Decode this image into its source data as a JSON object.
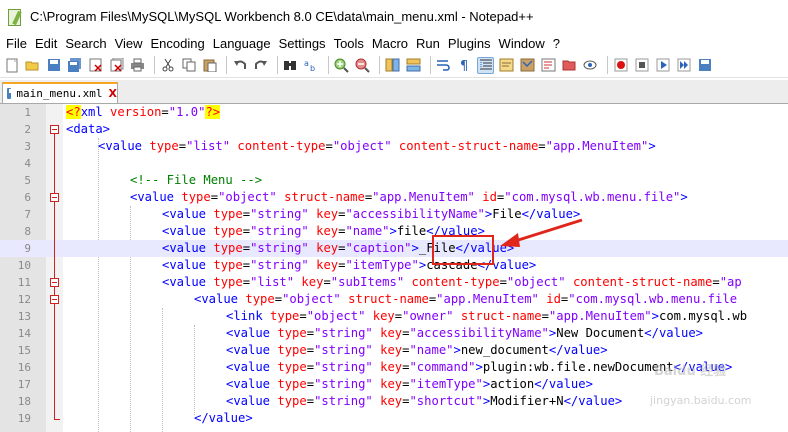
{
  "window": {
    "title": "C:\\Program Files\\MySQL\\MySQL Workbench 8.0 CE\\data\\main_menu.xml - Notepad++"
  },
  "menu": [
    "File",
    "Edit",
    "Search",
    "View",
    "Encoding",
    "Language",
    "Settings",
    "Tools",
    "Macro",
    "Run",
    "Plugins",
    "Window",
    "?"
  ],
  "toolbar": {
    "buttons": [
      "new-file",
      "open-file",
      "save",
      "save-all",
      "close",
      "close-all",
      "print",
      "cut",
      "copy",
      "paste",
      "undo",
      "redo",
      "find",
      "replace",
      "zoom-in",
      "zoom-out",
      "sync-vertical",
      "sync-horizontal",
      "word-wrap",
      "show-all-chars",
      "indent-guide",
      "user-language",
      "doc-map",
      "function-list",
      "folder-as-workspace",
      "monitor",
      "record-macro",
      "stop-record",
      "play-macro",
      "run-macro-multiple",
      "save-macro"
    ]
  },
  "tab": {
    "label": "main_menu.xml",
    "close": "X"
  },
  "editor": {
    "current_line": 9,
    "lines": [
      {
        "n": "1"
      },
      {
        "n": "2"
      },
      {
        "n": "3"
      },
      {
        "n": "4"
      },
      {
        "n": "5"
      },
      {
        "n": "6"
      },
      {
        "n": "7"
      },
      {
        "n": "8"
      },
      {
        "n": "9"
      },
      {
        "n": "10"
      },
      {
        "n": "11"
      },
      {
        "n": "12"
      },
      {
        "n": "13"
      },
      {
        "n": "14"
      },
      {
        "n": "15"
      },
      {
        "n": "16"
      },
      {
        "n": "17"
      },
      {
        "n": "18"
      },
      {
        "n": "19"
      }
    ],
    "code": {
      "l1": {
        "pi_open": "<?",
        "tag": "xml",
        "attr": " version",
        "eq": "=",
        "val": "\"1.0\"",
        "pi_close": "?>"
      },
      "l2": {
        "tag": "<data>"
      },
      "l3": {
        "a": "<value",
        "b": " type",
        "c": "=",
        "d": "\"list\"",
        "e": " content-type",
        "f": "=",
        "g": "\"object\"",
        "h": " content-struct-name",
        "i": "=",
        "j": "\"app.MenuItem\"",
        "k": ">"
      },
      "l5": {
        "comment": "<!-- File Menu -->"
      },
      "l6": {
        "a": "<value",
        "b": " type",
        "c": "=",
        "d": "\"object\"",
        "e": " struct-name",
        "f": "=",
        "g": "\"app.MenuItem\"",
        "h": " id",
        "i": "=",
        "j": "\"com.mysql.wb.menu.file\"",
        "k": ">"
      },
      "l7": {
        "a": "<value",
        "b": " type",
        "c": "=",
        "d": "\"string\"",
        "e": " key",
        "f": "=",
        "g": "\"accessibilityName\"",
        "h": ">",
        "t": "File",
        "z": "</value>"
      },
      "l8": {
        "a": "<value",
        "b": " type",
        "c": "=",
        "d": "\"string\"",
        "e": " key",
        "f": "=",
        "g": "\"name\"",
        "h": ">",
        "t": "file",
        "z": "</value>"
      },
      "l9": {
        "a": "<value",
        "b": " type",
        "c": "=",
        "d": "\"string\"",
        "e": " key",
        "f": "=",
        "g": "\"caption\"",
        "h": ">",
        "t": "_File",
        "z": "</value>"
      },
      "l10": {
        "a": "<value",
        "b": " type",
        "c": "=",
        "d": "\"string\"",
        "e": " key",
        "f": "=",
        "g": "\"itemType\"",
        "h": ">",
        "t": "cascade",
        "z": "</value>"
      },
      "l11": {
        "a": "<value",
        "b": " type",
        "c": "=",
        "d": "\"list\"",
        "e": " key",
        "f": "=",
        "g": "\"subItems\"",
        "h": " content-type",
        "i": "=",
        "j": "\"object\"",
        "k": " content-struct-name",
        "l": "=",
        "m": "\"ap"
      },
      "l12": {
        "a": "<value",
        "b": " type",
        "c": "=",
        "d": "\"object\"",
        "e": " struct-name",
        "f": "=",
        "g": "\"app.MenuItem\"",
        "h": " id",
        "i": "=",
        "j": "\"com.mysql.wb.menu.file"
      },
      "l13": {
        "a": "<link",
        "b": " type",
        "c": "=",
        "d": "\"object\"",
        "e": " key",
        "f": "=",
        "g": "\"owner\"",
        "h": " struct-name",
        "i": "=",
        "j": "\"app.MenuItem\"",
        "k": ">",
        "t": "com.mysql.wb"
      },
      "l14": {
        "a": "<value",
        "b": " type",
        "c": "=",
        "d": "\"string\"",
        "e": " key",
        "f": "=",
        "g": "\"accessibilityName\"",
        "h": ">",
        "t": "New Document",
        "z": "</value>"
      },
      "l15": {
        "a": "<value",
        "b": " type",
        "c": "=",
        "d": "\"string\"",
        "e": " key",
        "f": "=",
        "g": "\"name\"",
        "h": ">",
        "t": "new_document",
        "z": "</value>"
      },
      "l16": {
        "a": "<value",
        "b": " type",
        "c": "=",
        "d": "\"string\"",
        "e": " key",
        "f": "=",
        "g": "\"command\"",
        "h": ">",
        "t": "plugin:wb.file.newDocument",
        "z": "</value>"
      },
      "l17": {
        "a": "<value",
        "b": " type",
        "c": "=",
        "d": "\"string\"",
        "e": " key",
        "f": "=",
        "g": "\"itemType\"",
        "h": ">",
        "t": "action",
        "z": "</value>"
      },
      "l18": {
        "a": "<value",
        "b": " type",
        "c": "=",
        "d": "\"string\"",
        "e": " key",
        "f": "=",
        "g": "\"shortcut\"",
        "h": ">",
        "t": "Modifier+N",
        "z": "</value>"
      },
      "l19": {
        "z": "</value>"
      }
    }
  },
  "annotation": {
    "highlight_color": "#e0251b"
  },
  "watermark": {
    "logo": "Baidu 经验",
    "url": "jingyan.baidu.com"
  }
}
